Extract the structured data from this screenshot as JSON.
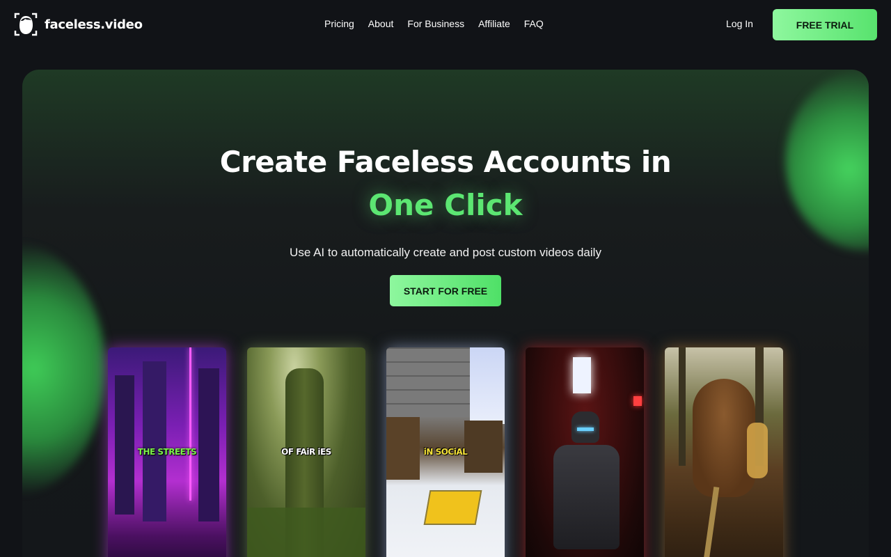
{
  "brand": {
    "name": "faceless.video"
  },
  "nav": {
    "items": [
      "Pricing",
      "About",
      "For Business",
      "Affiliate",
      "FAQ"
    ]
  },
  "header": {
    "login_label": "Log In",
    "trial_label": "FREE TRIAL"
  },
  "hero": {
    "title": "Create Faceless Accounts in",
    "title_accent": "One Click",
    "subtitle": "Use AI to automatically create and post custom videos daily",
    "cta_label": "START FOR FREE"
  },
  "videos": [
    {
      "caption": "THE STREETS",
      "caption_color": "#7cf04a"
    },
    {
      "caption": "OF FAiR iES",
      "caption_color": "#ffffff"
    },
    {
      "caption": "iN SOCiAL",
      "caption_color": "#f5e23a"
    },
    {
      "caption": "",
      "caption_color": "#ffffff"
    },
    {
      "caption": "",
      "caption_color": "#ffffff"
    }
  ],
  "colors": {
    "accent": "#5ce672",
    "background": "#111317"
  }
}
